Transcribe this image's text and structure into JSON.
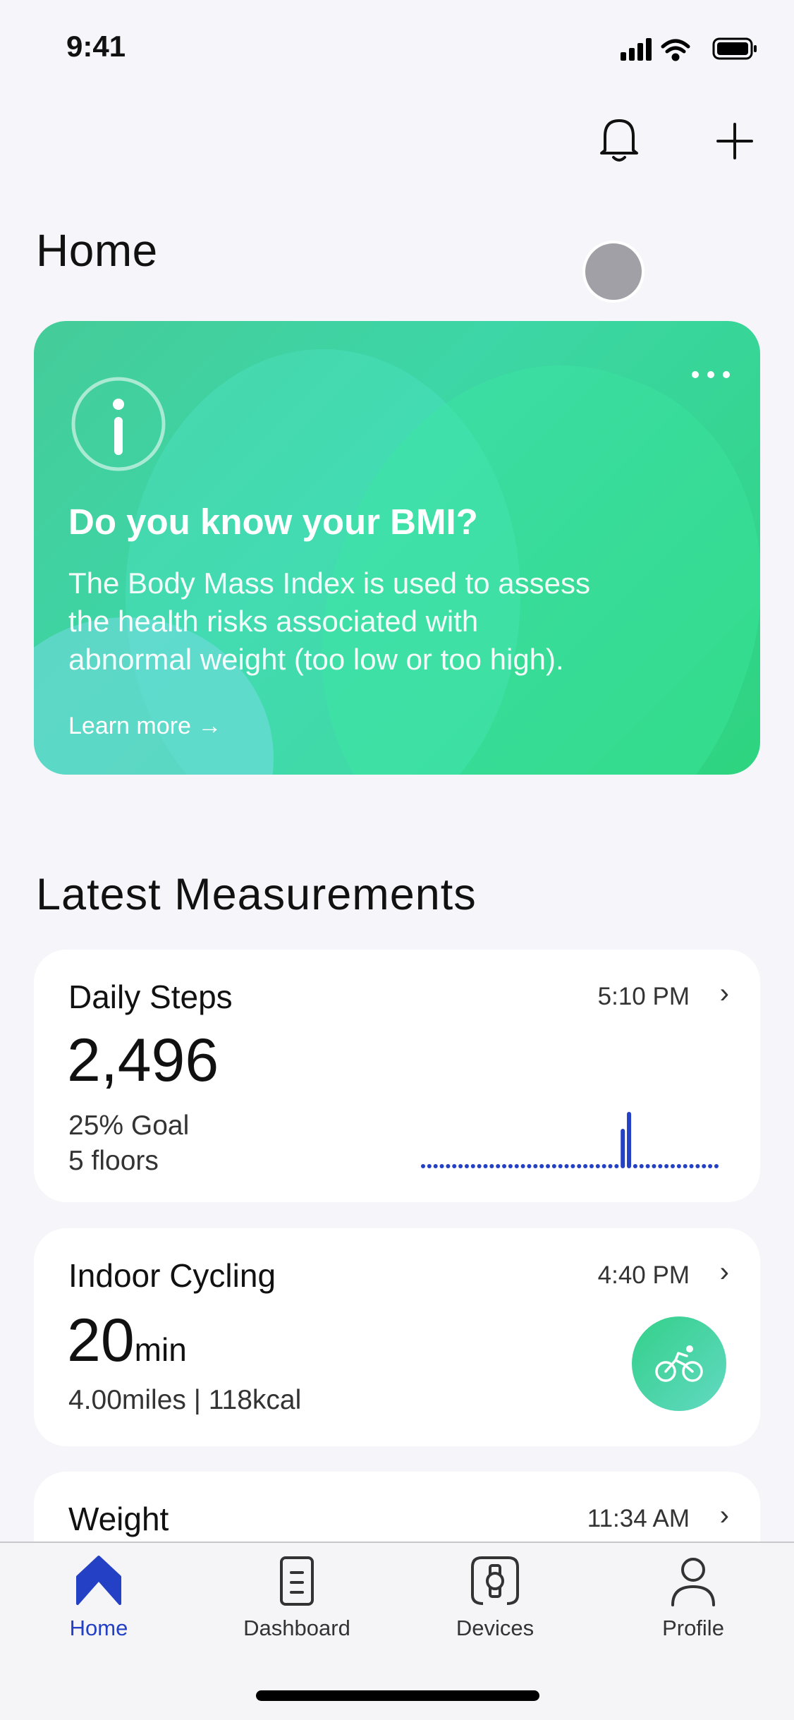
{
  "status_bar": {
    "time": "9:41"
  },
  "header": {
    "title": "Home",
    "bell_icon": "bell-icon",
    "add_icon": "plus-icon"
  },
  "promo_card": {
    "icon": "info-icon",
    "title": "Do you know your BMI?",
    "body_lines": [
      "The Body Mass Index is used to assess",
      "the health risks associated with",
      "abnormal weight (too low or too high)."
    ],
    "link": "Learn more →",
    "colors": {
      "gradient_start": "#45cc9a",
      "gradient_end": "#2ed47f"
    }
  },
  "section_title": "Latest Measurements",
  "measurements": [
    {
      "title": "Daily Steps",
      "time": "5:10 PM",
      "value": "2,496",
      "lines": [
        "25% Goal",
        "5 floors"
      ],
      "steps_chart": {
        "type": "bar",
        "color": "#2440c4",
        "values": [
          0,
          0,
          0,
          0,
          0,
          0,
          0,
          0,
          0,
          0,
          0,
          0,
          0,
          0,
          0,
          0,
          0,
          0,
          0,
          0,
          0,
          0,
          0,
          4,
          6,
          0,
          0,
          0,
          0,
          0,
          0,
          0,
          70,
          100,
          6,
          0,
          0,
          0,
          0,
          0,
          0,
          0,
          0,
          0,
          0,
          0,
          0,
          0
        ]
      }
    },
    {
      "title": "Indoor Cycling",
      "time": "4:40 PM",
      "value": "20",
      "unit": "min",
      "lines": [
        "4.00miles | 118kcal"
      ],
      "icon": "bicycle-icon"
    },
    {
      "title": "Weight",
      "time": "11:34 AM"
    }
  ],
  "tabs": [
    {
      "label": "Home",
      "icon": "home-icon",
      "active": true
    },
    {
      "label": "Dashboard",
      "icon": "dashboard-icon"
    },
    {
      "label": "Devices",
      "icon": "watch-icon"
    },
    {
      "label": "Profile",
      "icon": "person-icon"
    }
  ],
  "colors": {
    "accent": "#2440c4",
    "background": "#f6f6fa"
  }
}
